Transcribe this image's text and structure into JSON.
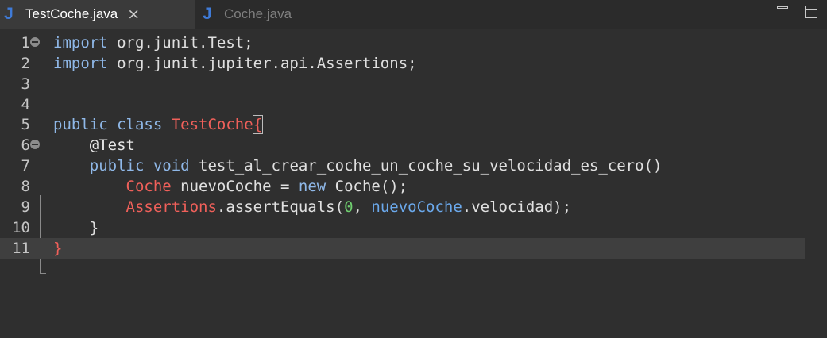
{
  "tabs": [
    {
      "label": "TestCoche.java",
      "icon": "java-file-icon",
      "active": true,
      "close": "×"
    },
    {
      "label": "Coche.java",
      "icon": "java-file-icon",
      "active": false
    }
  ],
  "icon_glyph": "J",
  "editor": {
    "lines": [
      {
        "num": "1",
        "code": [
          [
            "kw",
            "import"
          ],
          [
            "t",
            " org.junit.Test;"
          ]
        ]
      },
      {
        "num": "2",
        "code": [
          [
            "kw",
            "import"
          ],
          [
            "t",
            " org.junit.jupiter.api.Assertions;"
          ]
        ]
      },
      {
        "num": "3",
        "code": []
      },
      {
        "num": "4",
        "code": []
      },
      {
        "num": "5",
        "code": [
          [
            "kw",
            "public class"
          ],
          [
            "t",
            " "
          ],
          [
            "cls",
            "TestCoche"
          ],
          [
            "box",
            "{"
          ]
        ]
      },
      {
        "num": "6",
        "code": [
          [
            "t",
            "    "
          ],
          [
            "ann",
            "@Test"
          ]
        ]
      },
      {
        "num": "7",
        "code": [
          [
            "t",
            "    "
          ],
          [
            "kw",
            "public void"
          ],
          [
            "t",
            " test_al_crear_coche_un_coche_su_velocidad_es_cero()"
          ]
        ]
      },
      {
        "num": "8",
        "code": [
          [
            "t",
            "        "
          ],
          [
            "cls",
            "Coche"
          ],
          [
            "t",
            " nuevoCoche = "
          ],
          [
            "kw",
            "new"
          ],
          [
            "t",
            " Coche();"
          ]
        ]
      },
      {
        "num": "9",
        "code": [
          [
            "t",
            "        "
          ],
          [
            "cls",
            "Assertions"
          ],
          [
            "t",
            ".assertEquals("
          ],
          [
            "num",
            "0"
          ],
          [
            "t",
            ", "
          ],
          [
            "fld",
            "nuevoCoche"
          ],
          [
            "t",
            ".velocidad);"
          ]
        ]
      },
      {
        "num": "10",
        "code": [
          [
            "t",
            "    }"
          ]
        ]
      },
      {
        "num": "11",
        "code": [
          [
            "cls",
            "}"
          ]
        ]
      }
    ]
  },
  "colors": {
    "background": "#2f2f2f",
    "keyword": "#8fb8e8",
    "class_name": "#f0605a",
    "number": "#6fcf6f",
    "field": "#6ba9ec",
    "java_icon": "#3f7bd8"
  }
}
